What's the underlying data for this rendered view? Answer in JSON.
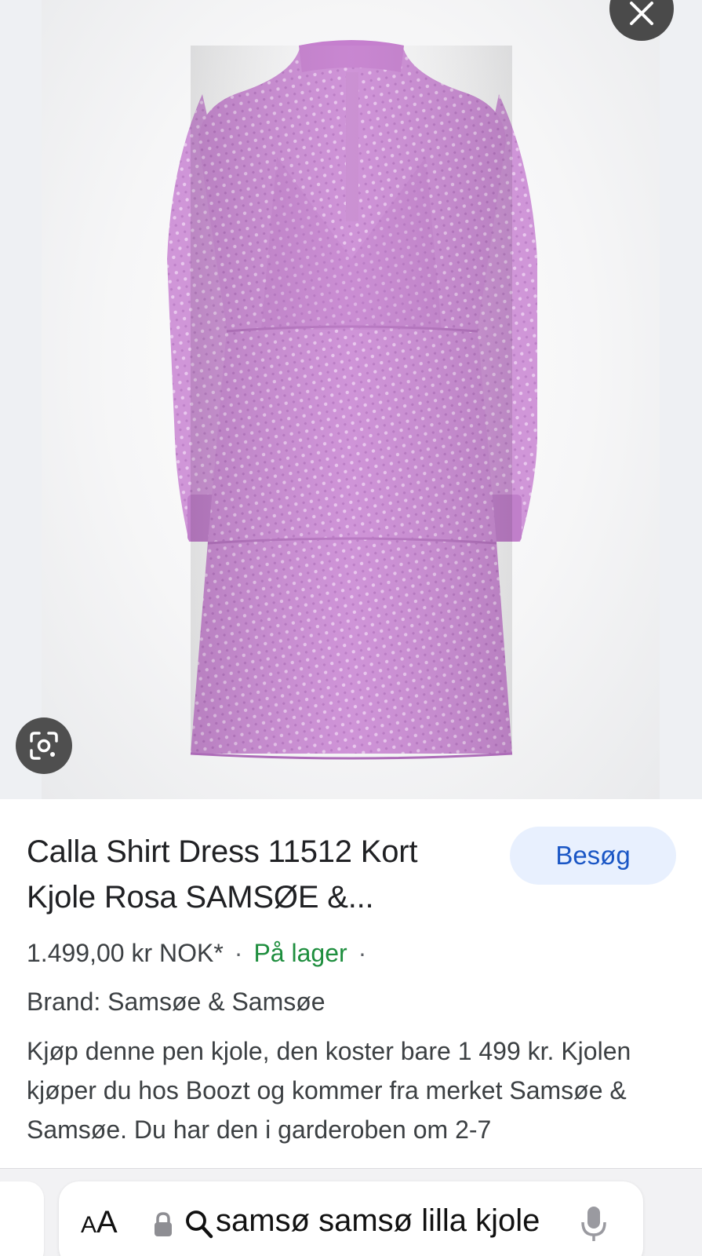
{
  "viewer": {
    "close_icon": "close-icon",
    "lens_icon": "google-lens-icon",
    "product_image": "pink-sheer-tiered-shirt-dress",
    "dress_color": "#cf8fd6"
  },
  "product": {
    "title": "Calla Shirt Dress 11512 Kort Kjole Rosa SAMSØE &...",
    "visit_label": "Besøg",
    "price": "1.499,00 kr NOK*",
    "separator": "·",
    "stock": "På lager",
    "brand": "Brand: Samsøe & Samsøe",
    "description": "Kjøp denne pen kjole, den koster bare 1 499 kr. Kjolen kjøper du hos Boozt og kommer fra merket Samsøe & Samsøe. Du har den i garderoben om 2-7"
  },
  "browser_bar": {
    "aa_small": "A",
    "aa_large": "A",
    "query": "samsø samsø lilla kjole",
    "icons": [
      "lock-icon",
      "search-icon",
      "microphone-icon"
    ]
  },
  "colors": {
    "visit_bg": "#e8f0fe",
    "visit_text": "#1a56c5",
    "stock_green": "#1e8e3e"
  }
}
